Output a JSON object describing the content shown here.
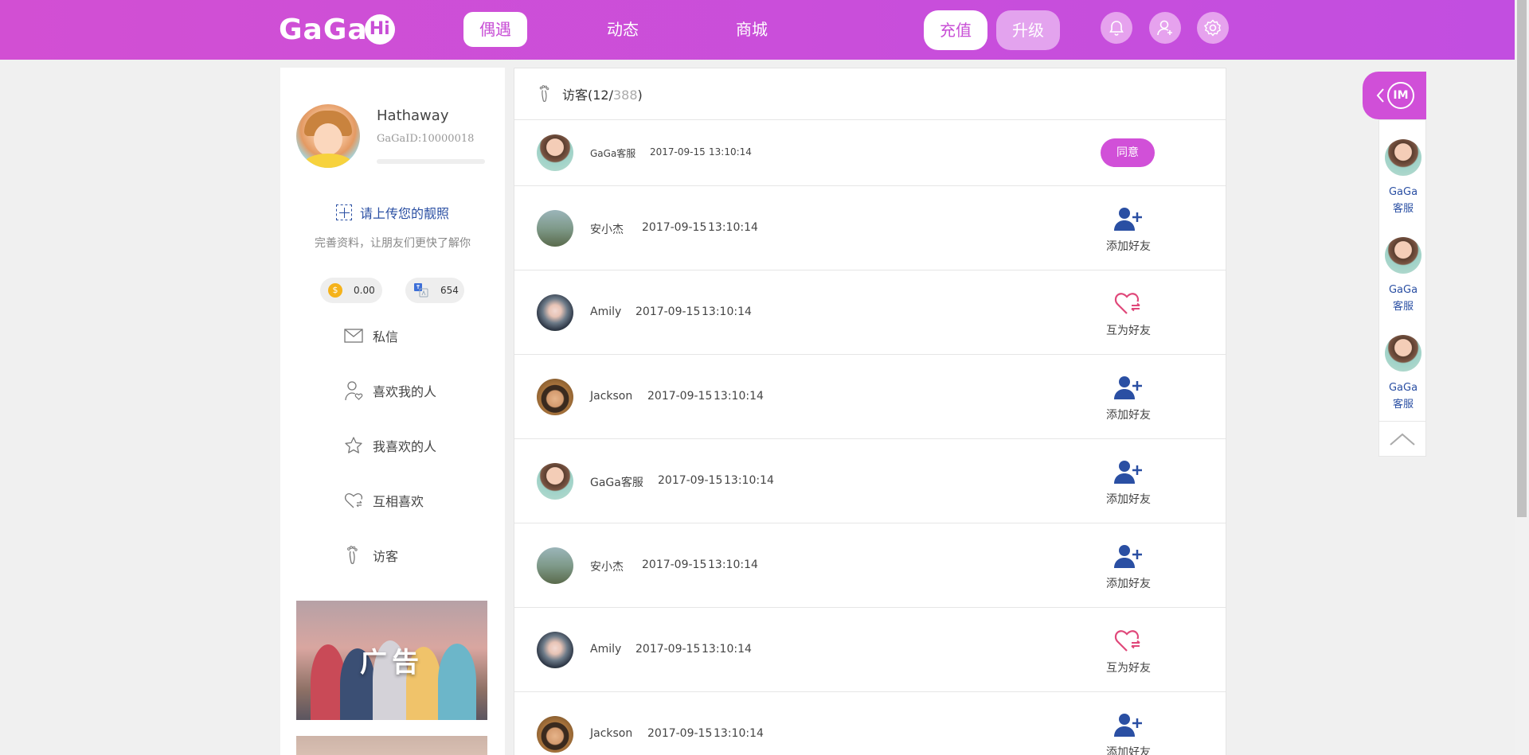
{
  "header": {
    "logo": "GaGa",
    "logo_badge": "Hi",
    "nav": [
      "偶遇",
      "动态",
      "商城"
    ],
    "recharge": "充值",
    "upgrade": "升级"
  },
  "profile": {
    "name": "Hathaway",
    "id": "GaGaID:10000018",
    "upload_label": "请上传您的靓照",
    "hint": "完善资料，让朋友们更快了解你",
    "coins": "0.00",
    "points": "654",
    "coin_symbol": "$"
  },
  "menu": [
    {
      "label": "私信"
    },
    {
      "label": "喜欢我的人"
    },
    {
      "label": "我喜欢的人"
    },
    {
      "label": "互相喜欢"
    },
    {
      "label": "访客"
    }
  ],
  "ad": {
    "label": "广告"
  },
  "visitors": {
    "title_prefix": "访客(12/",
    "total": "388",
    "title_suffix": ")",
    "rows": [
      {
        "name": "GaGa客服",
        "date": "2017-09-15",
        "time": "13:10:14",
        "action": "同意",
        "kind": "agree"
      },
      {
        "name": "安小杰",
        "date": "2017-09-15",
        "time": "13:10:14",
        "action": "添加好友",
        "kind": "add"
      },
      {
        "name": "Amily",
        "date": "2017-09-15",
        "time": "13:10:14",
        "action": "互为好友",
        "kind": "mutual"
      },
      {
        "name": "Jackson",
        "date": "2017-09-15",
        "time": "13:10:14",
        "action": "添加好友",
        "kind": "add"
      },
      {
        "name": "GaGa客服",
        "date": "2017-09-15",
        "time": "13:10:14",
        "action": "添加好友",
        "kind": "add"
      },
      {
        "name": "安小杰",
        "date": "2017-09-15",
        "time": "13:10:14",
        "action": "添加好友",
        "kind": "add"
      },
      {
        "name": "Amily",
        "date": "2017-09-15",
        "time": "13:10:14",
        "action": "互为好友",
        "kind": "mutual"
      },
      {
        "name": "Jackson",
        "date": "2017-09-15",
        "time": "13:10:14",
        "action": "添加好友",
        "kind": "add"
      }
    ]
  },
  "im": {
    "tab_label": "IM",
    "contacts": [
      {
        "line1": "GaGa",
        "line2": "客服"
      },
      {
        "line1": "GaGa",
        "line2": "客服"
      },
      {
        "line1": "GaGa",
        "line2": "客服"
      }
    ]
  },
  "colors": {
    "brand": "#d04fd8",
    "link": "#2a4fa3",
    "heart": "#e0487a"
  }
}
